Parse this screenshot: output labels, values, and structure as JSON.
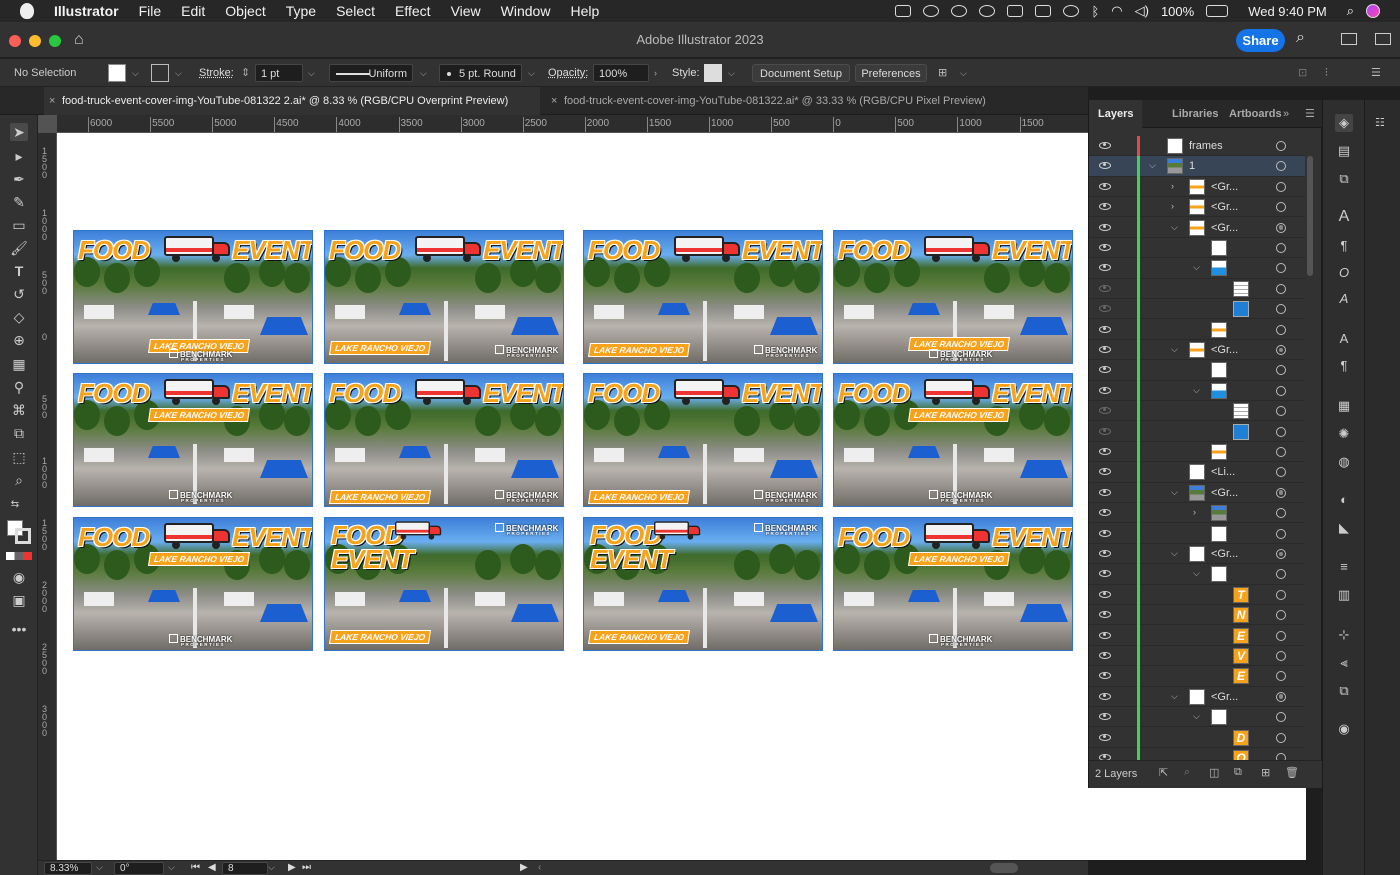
{
  "menubar": {
    "app": "Illustrator",
    "items": [
      "File",
      "Edit",
      "Object",
      "Type",
      "Select",
      "Effect",
      "View",
      "Window",
      "Help"
    ],
    "battery": "100%",
    "clock": "Wed 9:40 PM"
  },
  "titlebar": {
    "title": "Adobe Illustrator 2023",
    "share": "Share"
  },
  "control": {
    "selection": "No Selection",
    "stroke_label": "Stroke:",
    "stroke_weight": "1 pt",
    "profile": "Uniform",
    "brush": "5 pt. Round",
    "opacity_label": "Opacity:",
    "opacity": "100%",
    "style_label": "Style:",
    "doc_setup": "Document Setup",
    "preferences": "Preferences"
  },
  "tabs": [
    {
      "label": "food-truck-event-cover-img-YouTube-081322 2.ai* @ 8.33 % (RGB/CPU Overprint Preview)"
    },
    {
      "label": "food-truck-event-cover-img-YouTube-081322.ai* @ 33.33 % (RGB/CPU Pixel Preview)"
    }
  ],
  "ruler": {
    "h": [
      "6000",
      "5500",
      "5000",
      "4500",
      "4000",
      "3500",
      "3000",
      "2500",
      "2000",
      "1500",
      "1000",
      "500",
      "0",
      "500",
      "1000",
      "1500"
    ],
    "v": [
      "1500",
      "1000",
      "500",
      "0",
      "500",
      "1000",
      "1500",
      "2000",
      "2500",
      "3000"
    ]
  },
  "thumb": {
    "food": "FOOD",
    "event": "EVENT",
    "location": "LAKE RANCHO VIEJO",
    "brand": "BENCHMARK",
    "brand_sub": "PROPERTIES"
  },
  "panel": {
    "tabs": [
      "Layers",
      "Libraries",
      "Artboards"
    ],
    "rows": [
      {
        "name": "frames",
        "thumb": "white",
        "indent": 0,
        "toggle": "",
        "color": "#e04a4a",
        "eye": true,
        "target": false
      },
      {
        "name": "1",
        "thumb": "img",
        "indent": 0,
        "toggle": "v",
        "color": "#3fd34f",
        "eye": true,
        "target": false,
        "sel": true
      },
      {
        "name": "<Gr...",
        "thumb": "orange",
        "indent": 1,
        "toggle": ">",
        "color": "#3fd34f",
        "eye": true,
        "target": false
      },
      {
        "name": "<Gr...",
        "thumb": "orange",
        "indent": 1,
        "toggle": ">",
        "color": "#3fd34f",
        "eye": true,
        "target": false
      },
      {
        "name": "<Gr...",
        "thumb": "orange",
        "indent": 1,
        "toggle": "v",
        "color": "#3fd34f",
        "eye": true,
        "target": true
      },
      {
        "name": "",
        "thumb": "white",
        "indent": 2,
        "toggle": "",
        "color": "#3fd34f",
        "eye": true,
        "target": false
      },
      {
        "name": "",
        "thumb": "blue",
        "indent": 2,
        "toggle": "v",
        "color": "#3fd34f",
        "eye": true,
        "target": false
      },
      {
        "name": "",
        "thumb": "stripes",
        "indent": 3,
        "toggle": "",
        "color": "#3fd34f",
        "eye": false,
        "target": false
      },
      {
        "name": "",
        "thumb": "blueb",
        "indent": 3,
        "toggle": "",
        "color": "#3fd34f",
        "eye": false,
        "target": false
      },
      {
        "name": "",
        "thumb": "orange",
        "indent": 2,
        "toggle": "",
        "color": "#3fd34f",
        "eye": true,
        "target": false
      },
      {
        "name": "<Gr...",
        "thumb": "orange",
        "indent": 1,
        "toggle": "v",
        "color": "#3fd34f",
        "eye": true,
        "target": true
      },
      {
        "name": "",
        "thumb": "white",
        "indent": 2,
        "toggle": "",
        "color": "#3fd34f",
        "eye": true,
        "target": false
      },
      {
        "name": "",
        "thumb": "blue",
        "indent": 2,
        "toggle": "v",
        "color": "#3fd34f",
        "eye": true,
        "target": false
      },
      {
        "name": "",
        "thumb": "stripes",
        "indent": 3,
        "toggle": "",
        "color": "#3fd34f",
        "eye": false,
        "target": false
      },
      {
        "name": "",
        "thumb": "blueb",
        "indent": 3,
        "toggle": "",
        "color": "#3fd34f",
        "eye": false,
        "target": false
      },
      {
        "name": "",
        "thumb": "orange",
        "indent": 2,
        "toggle": "",
        "color": "#3fd34f",
        "eye": true,
        "target": false
      },
      {
        "name": "<Li...",
        "thumb": "white",
        "indent": 1,
        "toggle": "",
        "color": "#3fd34f",
        "eye": true,
        "target": false
      },
      {
        "name": "<Gr...",
        "thumb": "img",
        "indent": 1,
        "toggle": "v",
        "color": "#3fd34f",
        "eye": true,
        "target": true
      },
      {
        "name": "",
        "thumb": "img",
        "indent": 2,
        "toggle": ">",
        "color": "#3fd34f",
        "eye": true,
        "target": false
      },
      {
        "name": "",
        "thumb": "white",
        "indent": 2,
        "toggle": "",
        "color": "#3fd34f",
        "eye": true,
        "target": false
      },
      {
        "name": "<Gr...",
        "thumb": "logo",
        "indent": 1,
        "toggle": "v",
        "color": "#3fd34f",
        "eye": true,
        "target": true
      },
      {
        "name": "",
        "thumb": "logo",
        "indent": 2,
        "toggle": "v",
        "color": "#3fd34f",
        "eye": true,
        "target": false
      },
      {
        "name": "",
        "thumb": "letter",
        "letter": "T",
        "indent": 3,
        "toggle": "",
        "color": "#3fd34f",
        "eye": true,
        "target": false
      },
      {
        "name": "",
        "thumb": "letter",
        "letter": "N",
        "indent": 3,
        "toggle": "",
        "color": "#3fd34f",
        "eye": true,
        "target": false
      },
      {
        "name": "",
        "thumb": "letter",
        "letter": "E",
        "indent": 3,
        "toggle": "",
        "color": "#3fd34f",
        "eye": true,
        "target": false
      },
      {
        "name": "",
        "thumb": "letter",
        "letter": "V",
        "indent": 3,
        "toggle": "",
        "color": "#3fd34f",
        "eye": true,
        "target": false
      },
      {
        "name": "",
        "thumb": "letter",
        "letter": "E",
        "indent": 3,
        "toggle": "",
        "color": "#3fd34f",
        "eye": true,
        "target": false
      },
      {
        "name": "<Gr...",
        "thumb": "logo",
        "indent": 1,
        "toggle": "v",
        "color": "#3fd34f",
        "eye": true,
        "target": true
      },
      {
        "name": "",
        "thumb": "logo",
        "indent": 2,
        "toggle": "v",
        "color": "#3fd34f",
        "eye": true,
        "target": false
      },
      {
        "name": "",
        "thumb": "letter",
        "letter": "D",
        "indent": 3,
        "toggle": "",
        "color": "#3fd34f",
        "eye": true,
        "target": false
      },
      {
        "name": "",
        "thumb": "letter",
        "letter": "O",
        "indent": 3,
        "toggle": "",
        "color": "#3fd34f",
        "eye": true,
        "target": false
      }
    ],
    "footer": "2 Layers"
  },
  "status": {
    "zoom": "8.33%",
    "rotate": "0°",
    "artboard": "8"
  }
}
